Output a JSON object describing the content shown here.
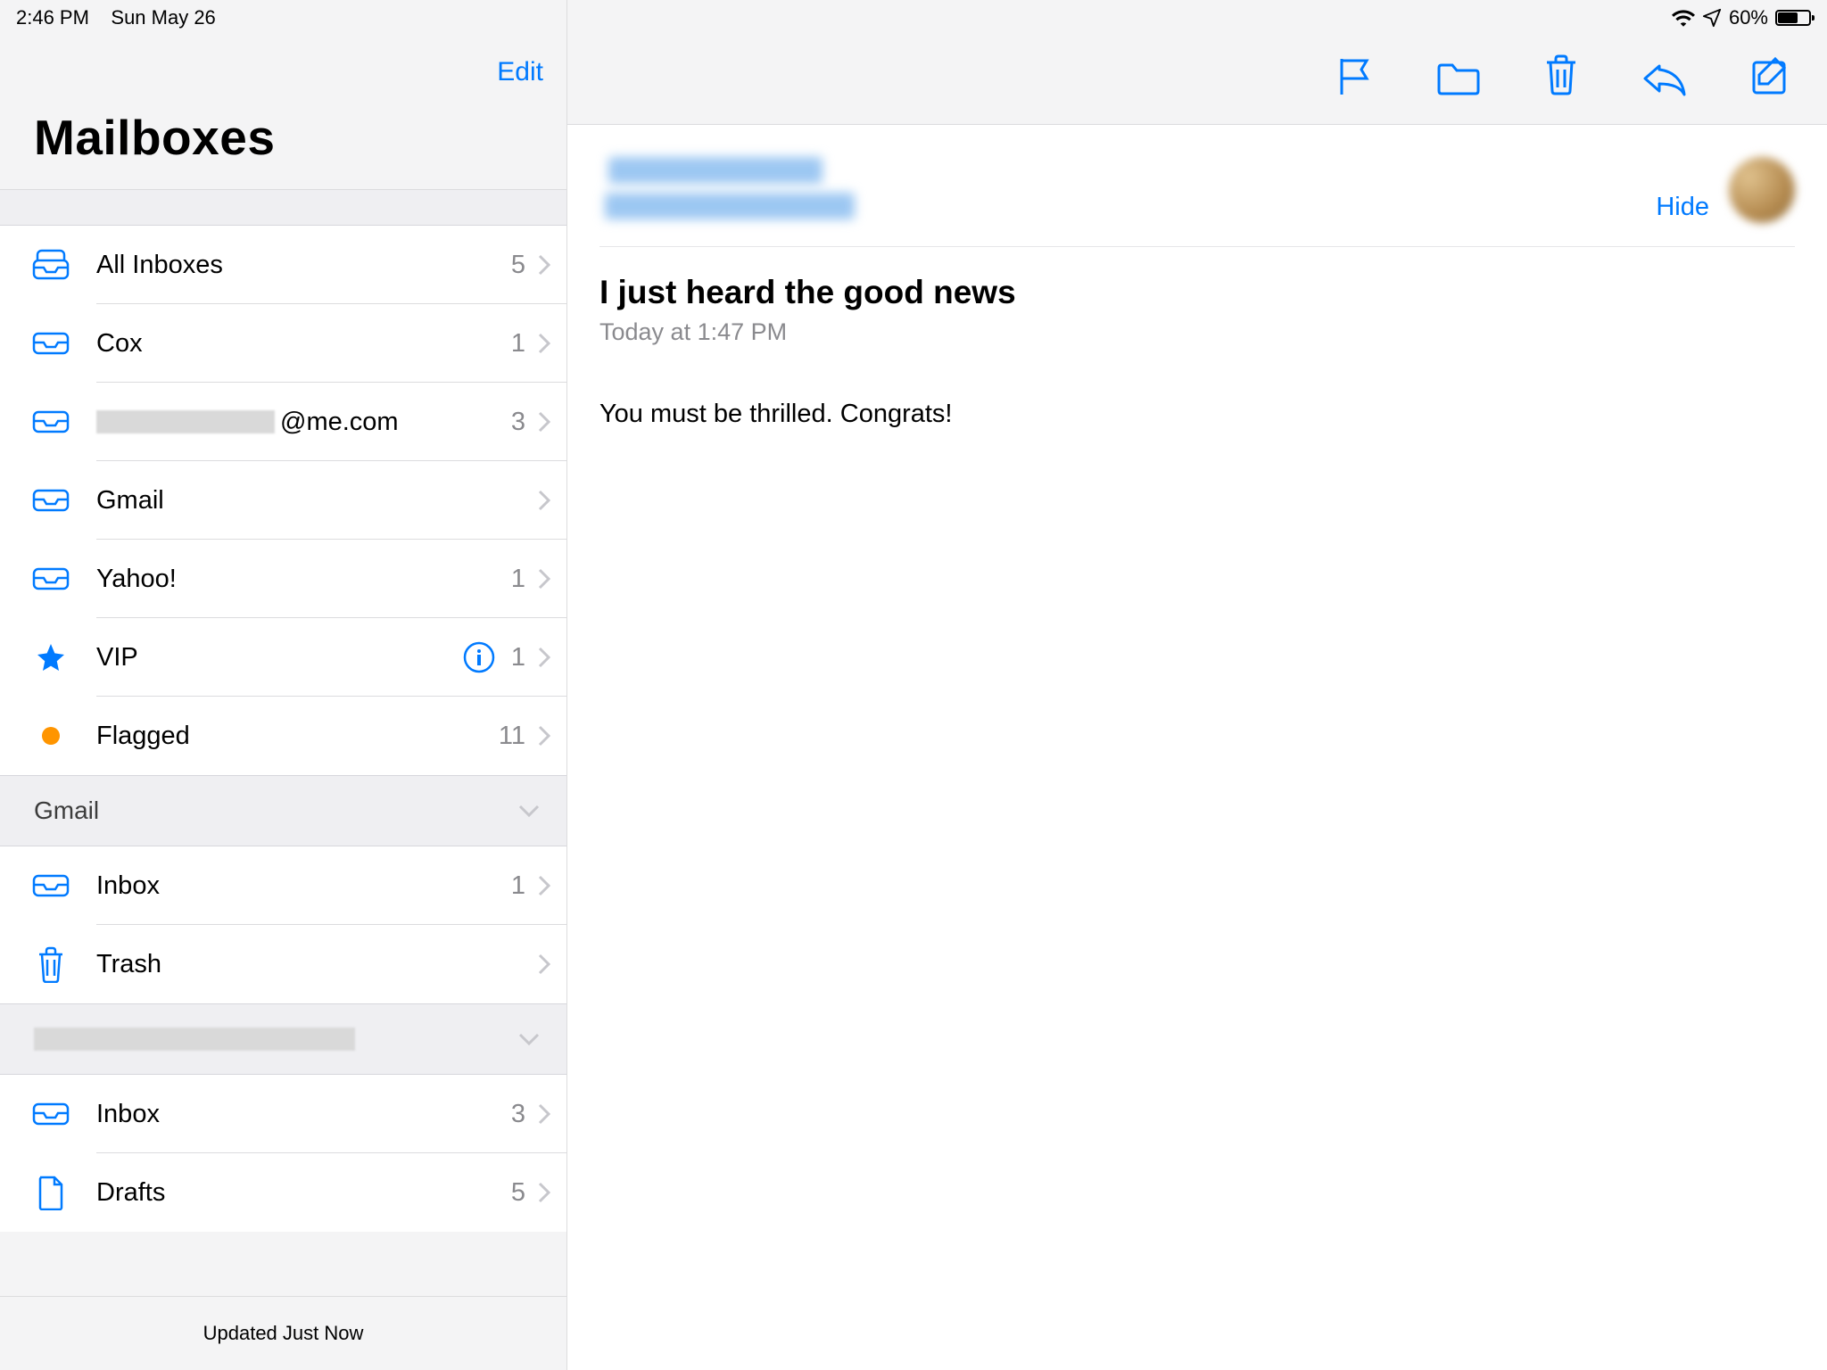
{
  "status": {
    "time": "2:46 PM",
    "date": "Sun May 26",
    "battery": "60%"
  },
  "sidebar": {
    "edit": "Edit",
    "title": "Mailboxes",
    "items": [
      {
        "label": "All Inboxes",
        "count": "5",
        "icon": "tray-stack"
      },
      {
        "label": "Cox",
        "count": "1",
        "icon": "tray"
      },
      {
        "label": "@me.com",
        "count": "3",
        "icon": "tray",
        "redacted_prefix": true
      },
      {
        "label": "Gmail",
        "count": "",
        "icon": "tray"
      },
      {
        "label": "Yahoo!",
        "count": "1",
        "icon": "tray"
      },
      {
        "label": "VIP",
        "count": "1",
        "icon": "star",
        "info": true
      },
      {
        "label": "Flagged",
        "count": "11",
        "icon": "dot"
      }
    ],
    "sections": [
      {
        "header": "Gmail",
        "items": [
          {
            "label": "Inbox",
            "count": "1",
            "icon": "tray"
          },
          {
            "label": "Trash",
            "count": "",
            "icon": "trash"
          }
        ]
      },
      {
        "header_redacted": true,
        "items": [
          {
            "label": "Inbox",
            "count": "3",
            "icon": "tray"
          },
          {
            "label": "Drafts",
            "count": "5",
            "icon": "doc"
          }
        ]
      }
    ],
    "footer": "Updated Just Now"
  },
  "message": {
    "hide": "Hide",
    "subject": "I just heard the good news",
    "timestamp": "Today at 1:47 PM",
    "body": "You must be thrilled. Congrats!"
  }
}
